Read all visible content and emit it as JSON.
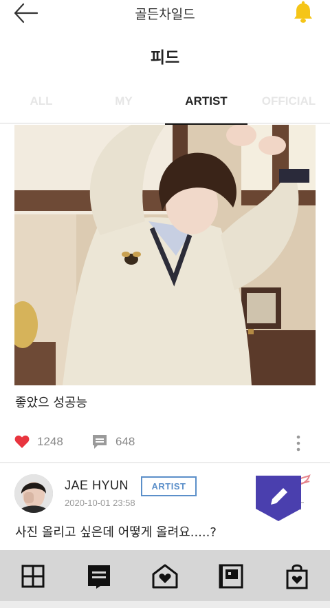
{
  "header": {
    "app_title": "골든차일드",
    "back_icon": "arrow-left-icon",
    "notification_icon": "bell-icon"
  },
  "page": {
    "title": "피드"
  },
  "tabs": [
    {
      "label": "ALL",
      "active": false
    },
    {
      "label": "MY",
      "active": false
    },
    {
      "label": "ARTIST",
      "active": true
    },
    {
      "label": "OFFICIAL",
      "active": false
    }
  ],
  "feed": [
    {
      "caption": "좋았으 성공능",
      "likes": "1248",
      "comments": "648"
    },
    {
      "author": "JAE HYUN",
      "badge": "ARTIST",
      "timestamp": "2020-10-01 23:58",
      "text": "사진 올리고 싶은데 어떻게 올려요.....?"
    }
  ],
  "bottom_nav": [
    {
      "name": "grid-icon"
    },
    {
      "name": "feed-icon"
    },
    {
      "name": "home-heart-icon"
    },
    {
      "name": "photo-album-icon"
    },
    {
      "name": "shop-bag-icon"
    }
  ],
  "colors": {
    "accent_yellow": "#f5c518",
    "like_red": "#e8353f",
    "badge_blue": "#5b8fc9",
    "fab_purple": "#4a3fae",
    "nav_bg": "#d6d6d6"
  }
}
